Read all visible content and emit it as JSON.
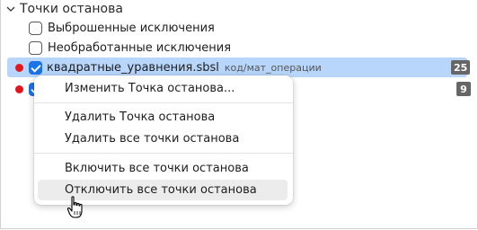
{
  "section": {
    "title": "Точки останова",
    "icon": "chevron-down-icon"
  },
  "exceptions": [
    {
      "label": "Выброшенные исключения",
      "checked": false
    },
    {
      "label": "Необработанные исключения",
      "checked": false
    }
  ],
  "breakpoints": [
    {
      "file": "квадратные_уравнения.sbsl",
      "path": "код/мат_операции",
      "count": "25",
      "checked": true,
      "selected": true
    },
    {
      "file": "",
      "path": "",
      "count": "9",
      "checked": true,
      "selected": false
    }
  ],
  "context_menu": {
    "items": [
      {
        "label": "Изменить Точка останова..."
      },
      {
        "label": "Удалить Точка останова"
      },
      {
        "label": "Удалить все точки останова"
      },
      {
        "label": "Включить все точки останова"
      },
      {
        "label": "Отключить все точки останова",
        "hovered": true
      }
    ]
  },
  "colors": {
    "selection": "#b8d6fb",
    "breakpoint_dot": "#e8141b",
    "checkbox_checked": "#1a73e8",
    "badge": "#666666"
  }
}
